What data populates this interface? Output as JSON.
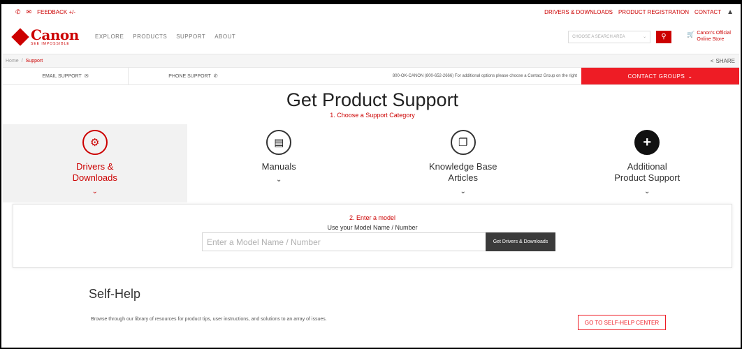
{
  "utility": {
    "feedback": "FEEDBACK +/-",
    "right_links": [
      "DRIVERS & DOWNLOADS",
      "PRODUCT REGISTRATION",
      "CONTACT"
    ]
  },
  "header": {
    "brand": "Canon",
    "tagline": "SEE IMPOSSIBLE",
    "nav": [
      "EXPLORE",
      "PRODUCTS",
      "SUPPORT",
      "ABOUT"
    ],
    "search_placeholder": "CHOOSE A SEARCH AREA",
    "store_line1": "Canon's Official",
    "store_line2": "Online Store"
  },
  "breadcrumb": {
    "items": [
      "Home",
      "Support"
    ],
    "share": "SHARE"
  },
  "support_bar": {
    "email": "EMAIL SUPPORT",
    "phone": "PHONE SUPPORT",
    "phone_text": "800-OK-CANON (800-652-2666)   For additional options please choose a Contact Group on the right",
    "contact_groups": "CONTACT GROUPS"
  },
  "main": {
    "title": "Get Product Support",
    "subtitle": "1. Choose a Support Category",
    "categories": [
      {
        "line1": "Drivers &",
        "line2": "Downloads",
        "icon": "gears-icon"
      },
      {
        "line1": "Manuals",
        "line2": "",
        "icon": "book-icon"
      },
      {
        "line1": "Knowledge Base",
        "line2": "Articles",
        "icon": "copy-icon"
      },
      {
        "line1": "Additional",
        "line2": "Product Support",
        "icon": "plus-icon"
      }
    ]
  },
  "model": {
    "step": "2. Enter a model",
    "sub": "Use your Model Name / Number",
    "placeholder": "Enter a Model Name / Number",
    "button": "Get Drivers & Downloads"
  },
  "self_help": {
    "title": "Self-Help",
    "description": "Browse through our library of resources for product tips, user instructions, and solutions to an array of issues.",
    "button": "GO TO SELF-HELP CENTER"
  },
  "colors": {
    "brand_red": "#cc0000",
    "contact_red": "#ee1c25"
  }
}
